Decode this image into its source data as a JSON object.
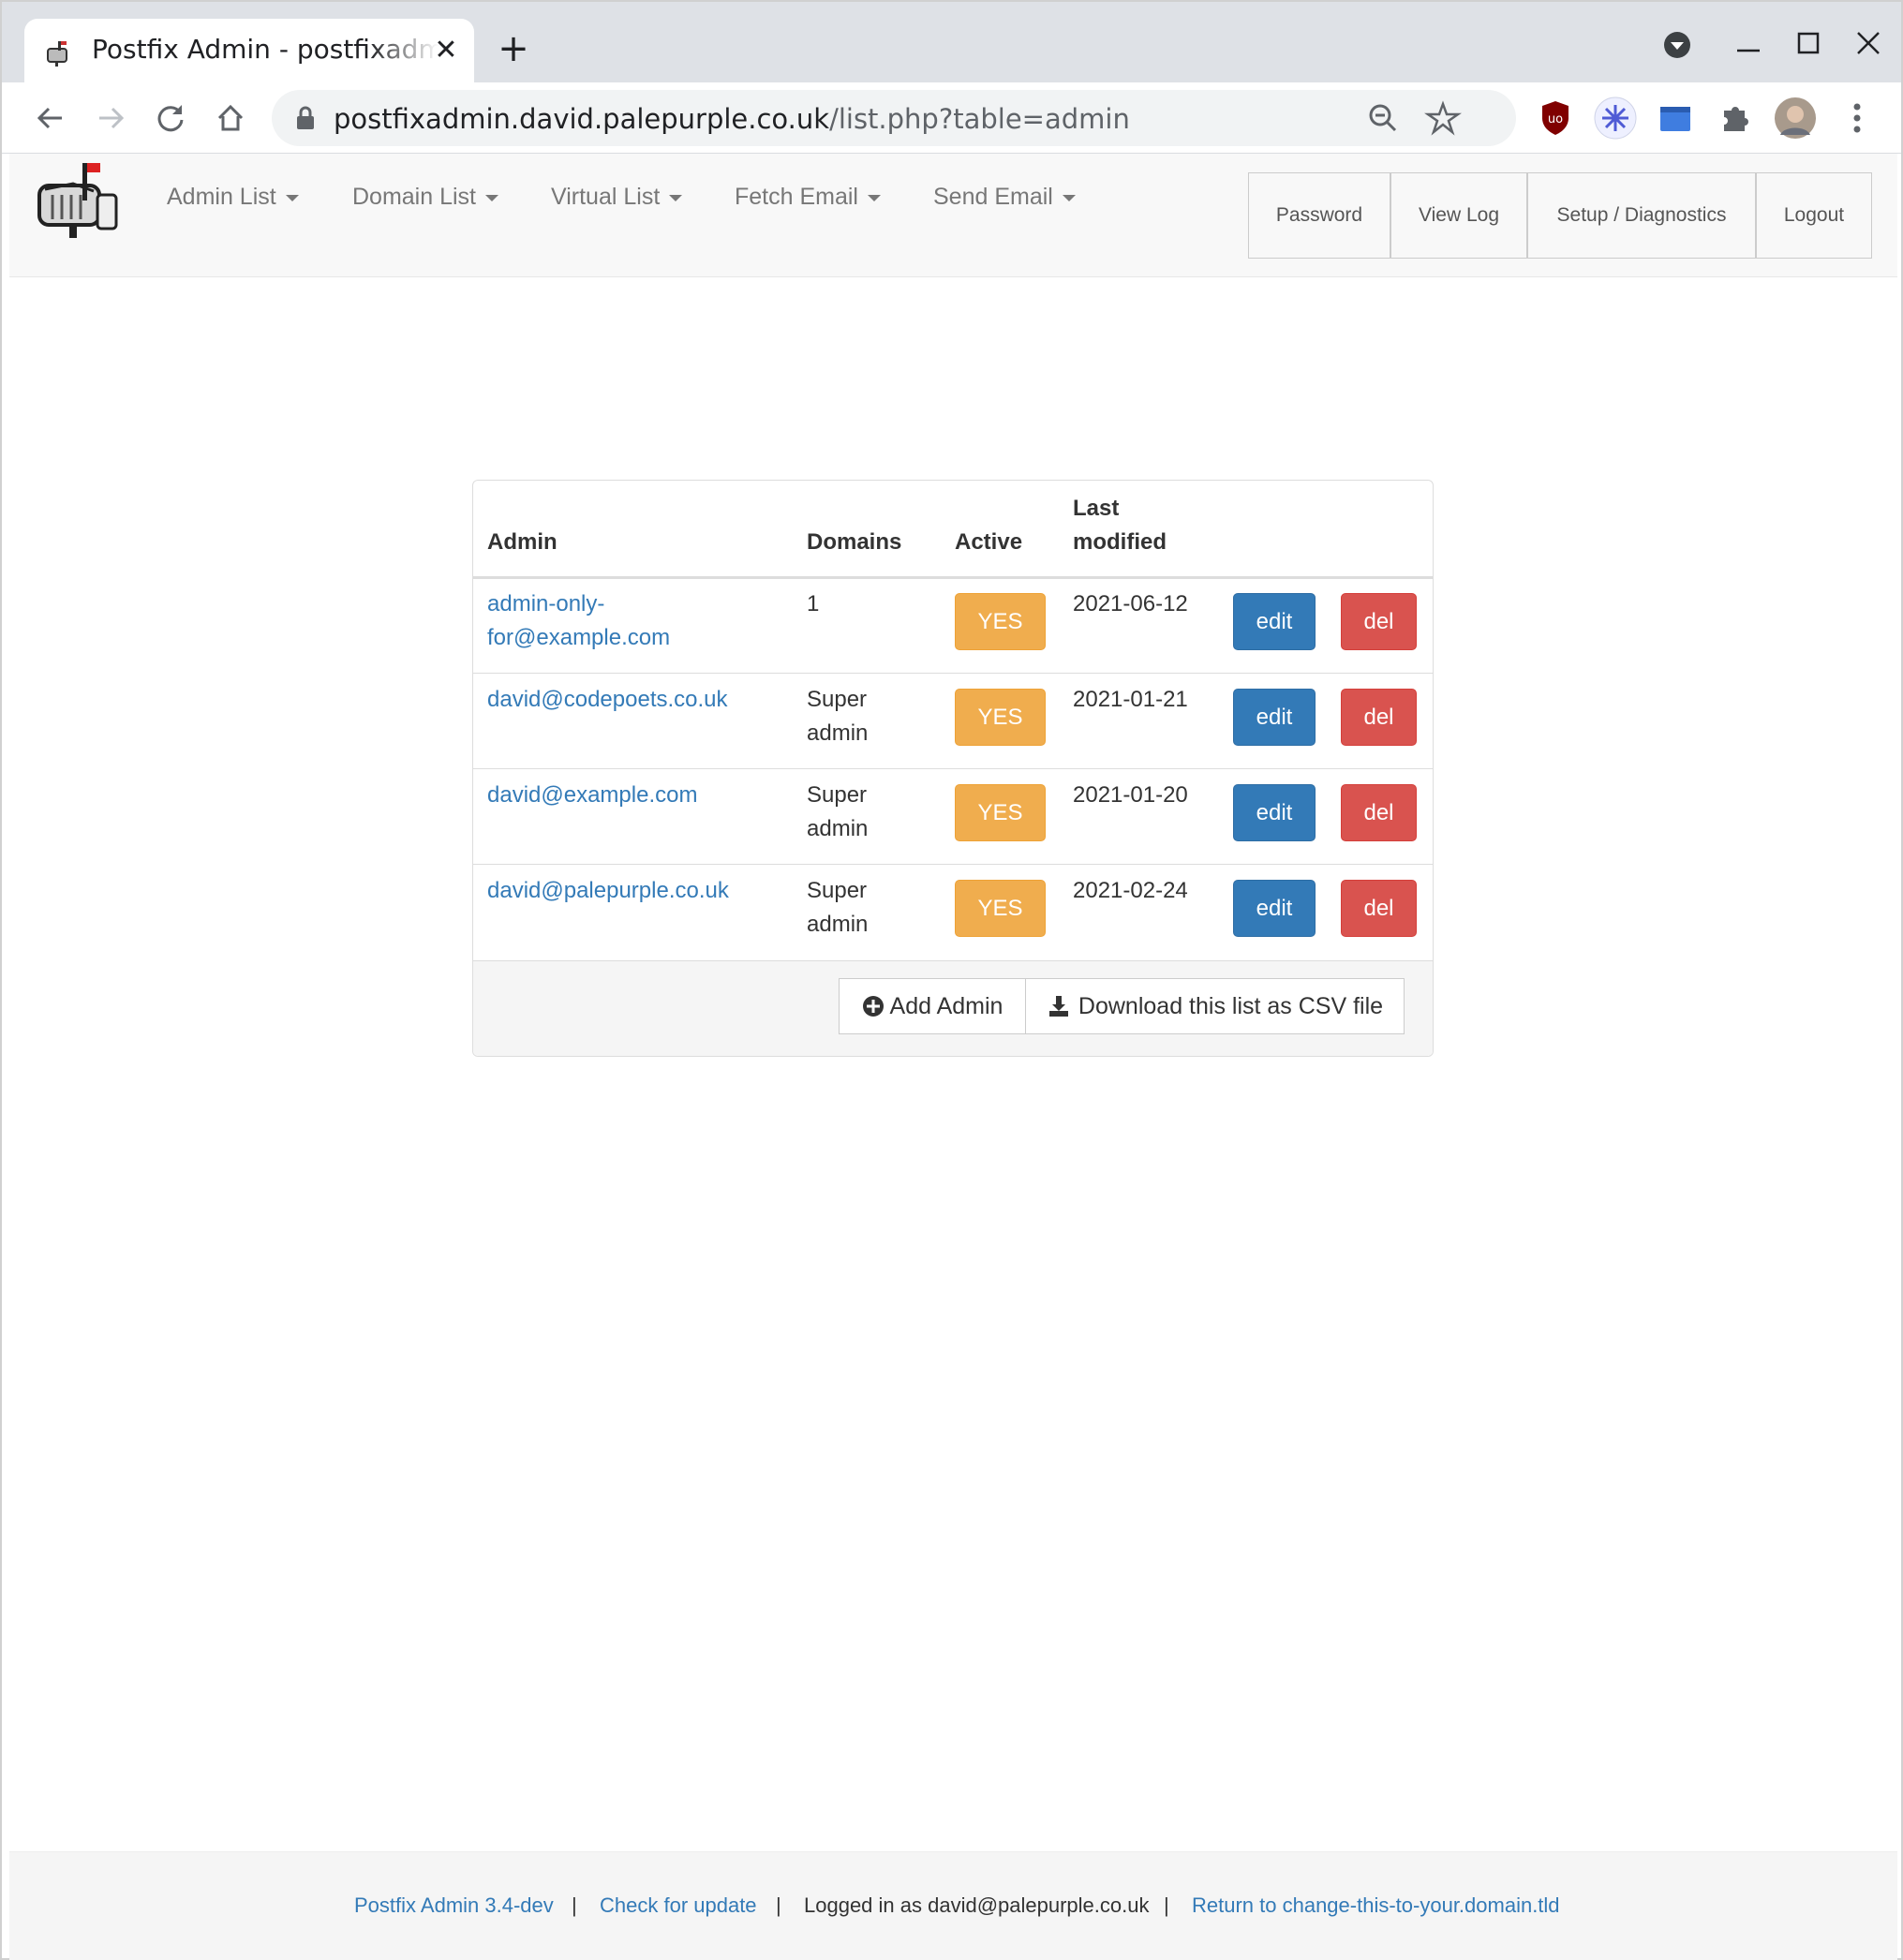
{
  "browser": {
    "tab_title": "Postfix Admin - postfixadmin.david.palepurple.co.uk",
    "tab_close": "✕",
    "new_tab": "+",
    "url_host": "postfixadmin.david.palepurple.co.uk",
    "url_path": "/list.php?table=admin"
  },
  "navbar": {
    "menu": [
      {
        "label": "Admin List"
      },
      {
        "label": "Domain List"
      },
      {
        "label": "Virtual List"
      },
      {
        "label": "Fetch Email"
      },
      {
        "label": "Send Email"
      }
    ],
    "right": [
      {
        "label": "Password"
      },
      {
        "label": "View Log"
      },
      {
        "label": "Setup / Diagnostics"
      },
      {
        "label": "Logout"
      }
    ]
  },
  "table": {
    "headers": {
      "admin": "Admin",
      "domains": "Domains",
      "active": "Active",
      "last_modified_1": "Last",
      "last_modified_2": "modified"
    },
    "rows": [
      {
        "admin_1": "admin-only-",
        "admin_2": "for@example.com",
        "domains_1": "1",
        "domains_2": "",
        "active": "YES",
        "modified": "2021-06-12",
        "edit": "edit",
        "del": "del"
      },
      {
        "admin_1": "david@codepoets.co.uk",
        "admin_2": "",
        "domains_1": "Super",
        "domains_2": "admin",
        "active": "YES",
        "modified": "2021-01-21",
        "edit": "edit",
        "del": "del"
      },
      {
        "admin_1": "david@example.com",
        "admin_2": "",
        "domains_1": "Super",
        "domains_2": "admin",
        "active": "YES",
        "modified": "2021-01-20",
        "edit": "edit",
        "del": "del"
      },
      {
        "admin_1": "david@palepurple.co.uk",
        "admin_2": "",
        "domains_1": "Super",
        "domains_2": "admin",
        "active": "YES",
        "modified": "2021-02-24",
        "edit": "edit",
        "del": "del"
      }
    ],
    "add_admin": "Add Admin",
    "download_csv": "Download this list as CSV file"
  },
  "footer": {
    "version": "Postfix Admin 3.4-dev",
    "check_update": "Check for update",
    "logged_in": "Logged in as david@palepurple.co.uk",
    "return_link": "Return to change-this-to-your.domain.tld",
    "separator": "|"
  },
  "colors": {
    "link": "#337ab7",
    "warning": "#f0ad4e",
    "primary": "#337ab7",
    "danger": "#d9534f"
  }
}
